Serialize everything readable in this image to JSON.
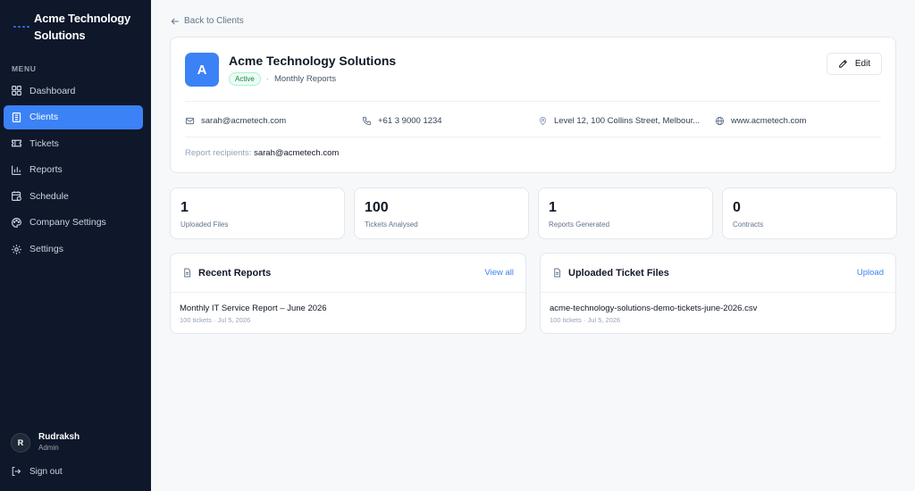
{
  "sidebar": {
    "brand": "Acme Technology Solutions",
    "menu_label": "MENU",
    "items": [
      {
        "label": "Dashboard",
        "icon": "dashboard-icon"
      },
      {
        "label": "Clients",
        "icon": "clients-icon"
      },
      {
        "label": "Tickets",
        "icon": "ticket-icon"
      },
      {
        "label": "Reports",
        "icon": "chart-icon"
      },
      {
        "label": "Schedule",
        "icon": "calendar-icon"
      },
      {
        "label": "Company Settings",
        "icon": "palette-icon"
      },
      {
        "label": "Settings",
        "icon": "gear-icon"
      }
    ],
    "active_item": "Clients",
    "user": {
      "initial": "R",
      "name": "Rudraksh",
      "role": "Admin"
    },
    "signout_label": "Sign out"
  },
  "back_label": "Back to Clients",
  "client": {
    "initial": "A",
    "name": "Acme Technology Solutions",
    "status": "Active",
    "separator": "·",
    "schedule": "Monthly Reports",
    "edit_label": "Edit",
    "email": "sarah@acmetech.com",
    "phone": "+61 3 9000 1234",
    "address": "Level 12, 100 Collins Street, Melbour...",
    "website": "www.acmetech.com",
    "recipients_label": "Report recipients:",
    "recipients_value": "sarah@acmetech.com"
  },
  "stats": [
    {
      "value": "1",
      "label": "Uploaded Files"
    },
    {
      "value": "100",
      "label": "Tickets Analysed"
    },
    {
      "value": "1",
      "label": "Reports Generated"
    },
    {
      "value": "0",
      "label": "Contracts"
    }
  ],
  "recent_reports": {
    "title": "Recent Reports",
    "link": "View all",
    "items": [
      {
        "title": "Monthly IT Service Report – June 2026",
        "sub": "100 tickets · Jul 5, 2026"
      }
    ]
  },
  "ticket_files": {
    "title": "Uploaded Ticket Files",
    "link": "Upload",
    "items": [
      {
        "title": "acme-technology-solutions-demo-tickets-june-2026.csv",
        "sub": "100 tickets · Jul 5, 2026"
      }
    ]
  },
  "colors": {
    "sidebar_bg": "#0f172a",
    "accent": "#3b82f6",
    "active_badge": "#15803d"
  }
}
